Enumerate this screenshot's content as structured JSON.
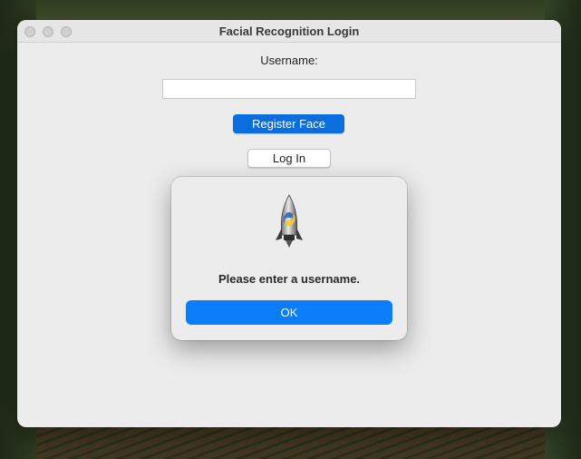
{
  "window": {
    "title": "Facial Recognition Login"
  },
  "form": {
    "username_label": "Username:",
    "username_value": "",
    "register_label": "Register Face",
    "login_label": "Log In"
  },
  "alert": {
    "icon": "python-rocket-icon",
    "message": "Please enter a username.",
    "ok_label": "OK"
  },
  "colors": {
    "accent": "#0a6ede",
    "ok_button": "#0a7ef8",
    "window_bg": "#ececec"
  }
}
